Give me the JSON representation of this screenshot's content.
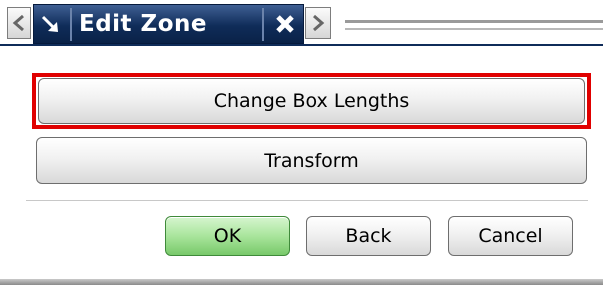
{
  "tab": {
    "title": "Edit Zone",
    "pin_icon": "pin-arrow-icon",
    "close_icon": "close-x-icon"
  },
  "nav": {
    "prev_icon": "chevron-left-icon",
    "next_icon": "chevron-right-icon"
  },
  "panel": {
    "change_box_lengths_label": "Change Box Lengths",
    "transform_label": "Transform",
    "highlighted_item": "Change Box Lengths"
  },
  "footer": {
    "ok_label": "OK",
    "back_label": "Back",
    "cancel_label": "Cancel"
  },
  "colors": {
    "tab_bg": "#0f2c59",
    "highlight": "#e00000",
    "ok_green": "#a9e59c"
  }
}
